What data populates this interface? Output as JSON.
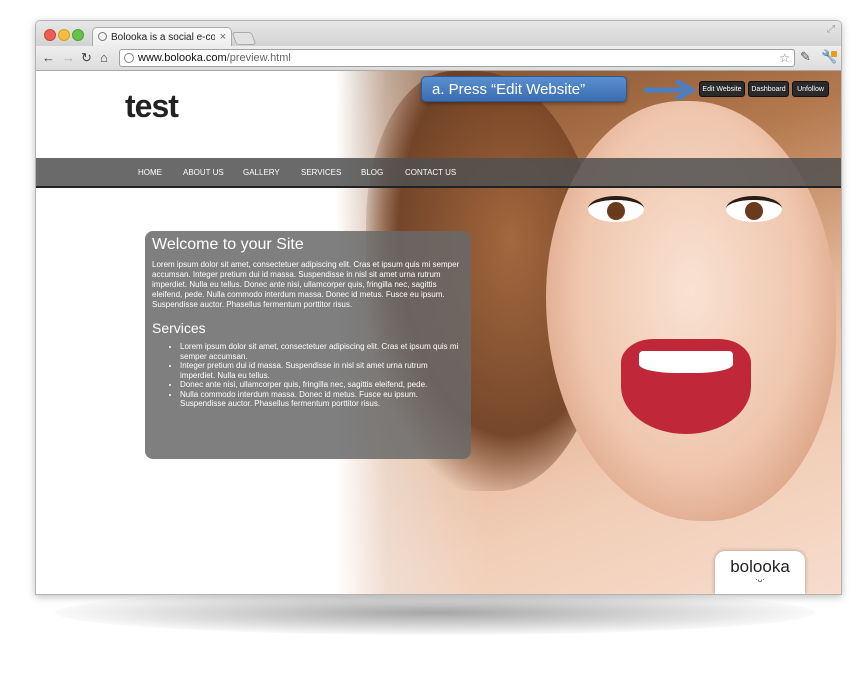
{
  "browser": {
    "tab_title": "Bolooka is a social e-comme",
    "tab_close": "×",
    "url_host": "www.bolooka.com",
    "url_path": "/preview.html",
    "star": "☆",
    "back": "←",
    "forward": "→",
    "reload": "↻",
    "home": "⌂",
    "resize": "⤢",
    "ext1": "✎",
    "ext2": "🔧"
  },
  "callout": {
    "text": "a. Press “Edit Website”",
    "color": "#4a7fc4"
  },
  "top_buttons": {
    "edit": "Edit Website",
    "dashboard": "Dashboard",
    "unfollow": "Unfollow"
  },
  "site": {
    "title": "test",
    "nav": [
      "HOME",
      "ABOUT US",
      "GALLERY",
      "SERVICES",
      "BLOG",
      "CONTACT US"
    ],
    "welcome_heading": "Welcome to your Site",
    "welcome_text": "Lorem ipsum dolor sit amet, consectetuer adipiscing elit. Cras et ipsum quis mi semper accumsan. Integer pretium dui id massa. Suspendisse in nisl sit amet urna rutrum imperdiet. Nulla eu tellus. Donec ante nisi, ullamcorper quis, fringilla nec, sagittis eleifend, pede. Nulla commodo interdum massa. Donec id metus. Fusce eu ipsum. Suspendisse auctor. Phasellus fermentum porttitor risus.",
    "services_heading": "Services",
    "services": [
      "Lorem ipsum dolor sit amet, consectetuer adipiscing elit. Cras et ipsum quis mi semper accumsan.",
      "Integer pretium dui id massa. Suspendisse in nisl sit amet urna rutrum imperdiet. Nulla eu tellus.",
      "Donec ante nisi, ullamcorper quis, fringilla nec, sagittis eleifend, pede.",
      "Nulla commodo interdum massa. Donec id metus. Fusce eu ipsum. Suspendisse auctor. Phasellus fermentum porttitor risus."
    ]
  },
  "badge": {
    "logo_text": "bolooka",
    "logo_mark": "·ᴗ·"
  }
}
